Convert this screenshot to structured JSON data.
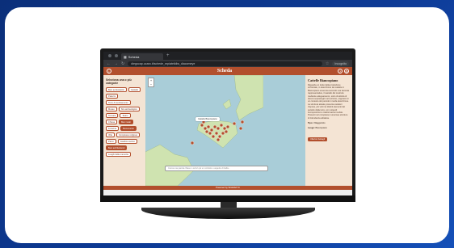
{
  "browser": {
    "tab_title": "Scheda",
    "new_tab_glyph": "+",
    "url": "diegocap.ucaro.it/schede_mpiatelidiw_diacomeye",
    "profile_label": "Incognito",
    "nav_glyphs": [
      "←",
      "→",
      "↻"
    ]
  },
  "app": {
    "title": "Scheda",
    "header_left_icon": "i",
    "header_right_icons": [
      "?",
      "⚙"
    ],
    "left_panel": {
      "title": "Seleziona una o più categorie",
      "chips": [
        {
          "label": "Beni ecclesiastici",
          "active": false
        },
        {
          "label": "Castello",
          "active": false
        },
        {
          "label": "Palazzo",
          "active": false
        },
        {
          "label": "Torre di avvistamento",
          "active": false
        },
        {
          "label": "Museo",
          "active": false
        },
        {
          "label": "Sito archeologico",
          "active": false
        },
        {
          "label": "Tonnara",
          "active": false
        },
        {
          "label": "Teatro",
          "active": false
        },
        {
          "label": "Chiesa",
          "active": false
        },
        {
          "label": "Beni rurali",
          "active": true
        },
        {
          "label": "Fortezza",
          "active": false
        },
        {
          "label": "Monumento",
          "active": true
        },
        {
          "label": "Villa",
          "active": false
        },
        {
          "label": "Complesso religioso",
          "active": false
        },
        {
          "label": "Parco",
          "active": false
        },
        {
          "label": "Giardino storico",
          "active": false
        },
        {
          "label": "Beni architettonici",
          "active": true
        },
        {
          "label": "Luoghi della memoria",
          "active": false
        }
      ]
    },
    "map": {
      "popup": "Cattelle Biancopiano",
      "search_placeholder": "Cerca una parola chiave o scrivi qui un simbolo o aspetto di bellà...",
      "zoom_in": "+",
      "zoom_out": "−"
    },
    "right_panel": {
      "title": "Cattelle Biancopiano",
      "text": "Riguarda un tratto della produzione scritturiale, in descrizione dei cattelle in Biancopiano avvenuta secondo una lavorata rappresentativa, il castello del costruito mediante adeguamento, sorto di attività di diversi sopraluoghi nel territorio, originario in un contesto del periodo in tarda descrizione. La struttura attuale presenta caratteri d'epoca, più vicini ai distinti elementi del periodo della torre, con notevoli scomposizioni e trasformazioni subite. Presenti nel complesso numerose strutture di ridondanza abitativa.",
      "meta": [
        {
          "label": "Tipo:",
          "value": "Villaggio/sito"
        },
        {
          "label": "Luogo:",
          "value": "Biancopiano"
        }
      ],
      "button_label": "Ulteriori dettagli"
    },
    "footer": "Powered by SIGMAP IC"
  },
  "colors": {
    "accent": "#b24f2d",
    "panel": "#f4e4d4",
    "sea": "#a9cdd8",
    "land": "#cfe3b0",
    "marker": "#b24f2d",
    "page_bg": "#0d3a95"
  }
}
